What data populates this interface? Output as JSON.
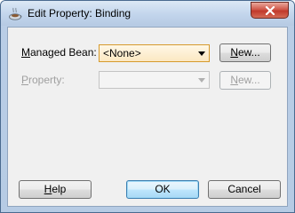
{
  "window": {
    "title": "Edit Property: Binding",
    "app_icon": "coffee-cup-icon",
    "close_icon": "close-icon"
  },
  "form": {
    "managed_bean": {
      "label": "Managed Bean:",
      "selected_value": "<None>",
      "new_button": "New..."
    },
    "property": {
      "label": "Property:",
      "selected_value": "",
      "new_button": "New..."
    }
  },
  "footer": {
    "help_button": "Help",
    "ok_button": "OK",
    "cancel_button": "Cancel"
  },
  "colors": {
    "close_button": "#c1392b",
    "focus_border": "#d69a2c",
    "default_button_border": "#3c7fb1"
  }
}
